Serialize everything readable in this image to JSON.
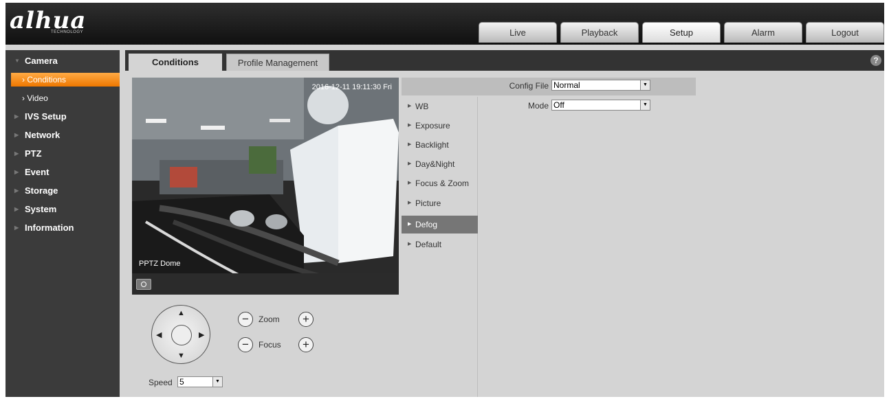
{
  "header": {
    "logo": "alhua",
    "logo_sub": "TECHNOLOGY",
    "nav": [
      "Live",
      "Playback",
      "Setup",
      "Alarm",
      "Logout"
    ],
    "active_nav": "Setup"
  },
  "sidebar": {
    "camera": "Camera",
    "conditions": "Conditions",
    "video": "Video",
    "items": [
      "IVS Setup",
      "Network",
      "PTZ",
      "Event",
      "Storage",
      "System",
      "Information"
    ]
  },
  "tabs": {
    "conditions": "Conditions",
    "profile": "Profile Management",
    "help": "?"
  },
  "video": {
    "timestamp": "2016-12-11 19:11:30 Fri",
    "channel_name": "PPTZ Dome"
  },
  "submenu": [
    "WB",
    "Exposure",
    "Backlight",
    "Day&Night",
    "Focus & Zoom",
    "Picture",
    "Defog",
    "Default"
  ],
  "active_submenu": "Defog",
  "config": {
    "config_file_label": "Config File",
    "config_file_value": "Normal",
    "mode_label": "Mode",
    "mode_value": "Off"
  },
  "ptz": {
    "zoom_label": "Zoom",
    "focus_label": "Focus",
    "speed_label": "Speed",
    "speed_value": "5"
  },
  "colors": {
    "accent": "#ff8c1a",
    "active_submenu_bg": "#767676",
    "sidebar_bg": "#3b3b3b",
    "header_bg": "#1c1c1c"
  }
}
